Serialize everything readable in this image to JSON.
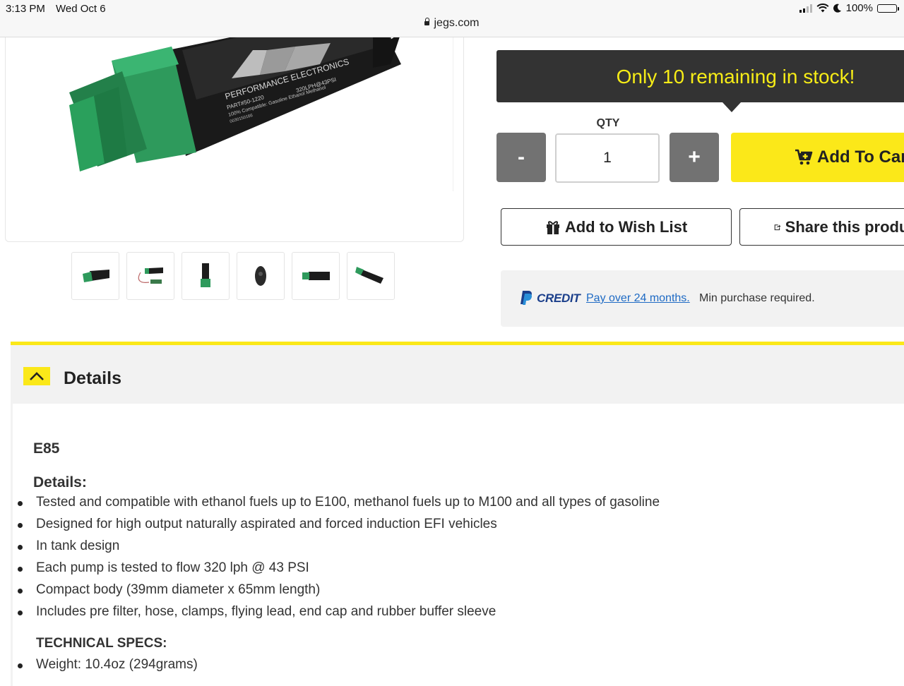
{
  "status_bar": {
    "time": "3:13 PM",
    "date": "Wed Oct 6",
    "battery": "100%",
    "url": "jegs.com"
  },
  "product_image": {
    "label_brand": "PERFORMANCE ELECTRONICS",
    "label_part": "PART#50-1220",
    "label_flow": "320LPH@43PSI",
    "label_compat": "100% Compatible: Gasoline Ethanol Methanol",
    "label_serial": "0030150166"
  },
  "thumbnails": [
    "pump-front",
    "pump-with-lead",
    "pump-vertical",
    "pump-end",
    "pump-side",
    "pump-angled"
  ],
  "stock": {
    "message": "Only 10 remaining in stock!"
  },
  "qty": {
    "label": "QTY",
    "value": "1",
    "minus": "-",
    "plus": "+"
  },
  "buttons": {
    "add_to_cart": "Add To Cart",
    "wish_list": "Add to Wish List",
    "share": "Share this product"
  },
  "paypal": {
    "credit": "CREDIT",
    "link": "Pay over 24 months.",
    "note": "Min purchase required."
  },
  "details": {
    "title": "Details",
    "fuel": "E85",
    "subheading": "Details:",
    "items": [
      "Tested and compatible with ethanol fuels up to E100, methanol fuels up to M100 and all types of gasoline",
      "Designed for high output naturally aspirated and forced induction EFI vehicles",
      "In tank design",
      "Each pump is tested to flow 320 lph @ 43 PSI",
      "Compact body (39mm diameter x 65mm length)",
      "Includes pre filter, hose, clamps, flying lead, end cap and rubber buffer sleeve"
    ],
    "tech_heading": "TECHNICAL SPECS:",
    "tech_items": [
      "Weight: 10.4oz (294grams)"
    ]
  },
  "colors": {
    "accent_yellow": "#fbe819",
    "stock_text": "#f6ec17",
    "dark_bar": "#333333",
    "qty_button": "#727272",
    "paypal_blue": "#1b3f8b",
    "link_blue": "#1e6ac4"
  }
}
